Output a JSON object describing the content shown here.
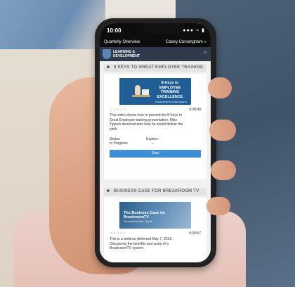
{
  "status_bar": {
    "time": "10:00",
    "icons": "●●● ⌁ ▮"
  },
  "top_bar": {
    "left_label": "Quarterly Overview",
    "user_name": "Casey Cunningham"
  },
  "brand": {
    "line1": "LEARNING &",
    "line2": "DEVELOPMENT",
    "menu_glyph": "≡"
  },
  "sections": [
    {
      "heading": "8 KEYS TO GREAT EMPLOYEE TRAINING",
      "thumb_title": "8 Keys to EMPLOYEE TRAINING EXCELLENCE",
      "thumb_credit": "PRESENTED BY MIKE TIPPETS",
      "stars": "☆☆☆☆☆",
      "duration": "0:08:48",
      "description": "This video shows how to present the 8 Keys to Great Employee training presentation. Mike Tippets demonstrates how he would deliver the pitch.",
      "status_label": "Status:",
      "status_value": "In Progress",
      "expires_label": "Expires:",
      "expires_value": "--",
      "button": "Start"
    },
    {
      "heading": "BUSINESS CASE FOR BREAKROOM TV",
      "thumb_title": "The Business Case for BreakroomTV",
      "thumb_sub": "Presented by Mike Tippets",
      "stars": "☆☆☆☆☆",
      "duration": "0:30:57",
      "description": "This is a webinar delivered May 7, 2019. Discussing the benefits and costs of a BreakroomTV system."
    }
  ],
  "colors": {
    "accent": "#3c8fd4",
    "brand_bar": "#2f3a4c",
    "status_dot": "#4caf50"
  }
}
